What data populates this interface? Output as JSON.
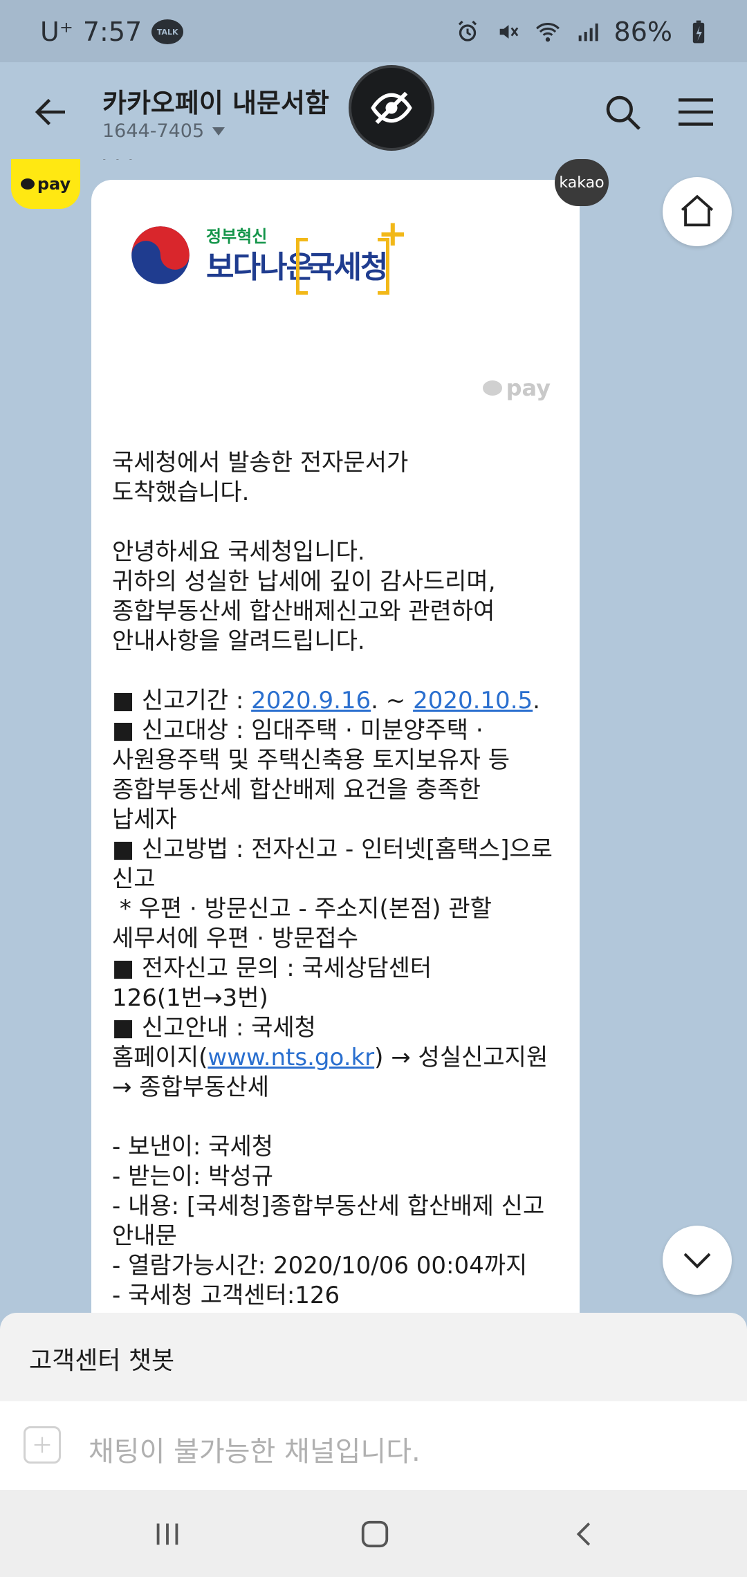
{
  "status_bar": {
    "carrier": "U⁺",
    "time": "7:57",
    "talk_label": "TALK",
    "battery": "86%"
  },
  "header": {
    "title": "카카오페이 내문서함",
    "phone": "1644-7405"
  },
  "message": {
    "sender_cut": "· · ·",
    "kakao_badge": "kakao",
    "logo_small": "정부혁신",
    "logo_big": "보다나은",
    "logo_org": "국세청",
    "pay_label": "pay",
    "intro": "국세청에서 발송한 전자문서가\n도착했습니다.",
    "greeting": "안녕하세요 국세청입니다.\n귀하의 성실한 납세에 깊이 감사드리며,\n종합부동산세 합산배제신고와 관련하여\n안내사항을 알려드립니다.",
    "period_label": "■ 신고기간 : ",
    "period_start": "2020.9.16",
    "period_sep": ". ~ ",
    "period_end": "2020.10.5",
    "period_end_dot": ".",
    "target": "■ 신고대상 : 임대주택 · 미분양주택 ·\n사원용주택 및 주택신축용 토지보유자 등\n종합부동산세 합산배제 요건을 충족한\n납세자",
    "method": "■ 신고방법 : 전자신고 - 인터넷[홈택스]으로\n신고\n * 우편 · 방문신고 - 주소지(본점) 관할\n세무서에 우편 · 방문접수",
    "inquiry": "■ 전자신고 문의 : 국세상담센터\n126(1번→3번)",
    "guide_prefix": "■ 신고안내 : 국세청\n홈페이지(",
    "guide_link": "www.nts.go.kr",
    "guide_suffix": ") → 성실신고지원\n→ 종합부동산세",
    "details": "- 보낸이: 국세청\n- 받는이: 박성규\n- 내용: [국세청]종합부동산세 합산배제 신고\n안내문\n- 열람가능시간: 2020/10/06 00:04까지\n- 국세청 고객센터:126"
  },
  "chatbot": {
    "label": "고객센터 챗봇"
  },
  "input": {
    "placeholder": "채팅이 불가능한 채널입니다."
  },
  "icons": {
    "back": "arrow-left-icon",
    "eye": "eye-off-icon",
    "search": "search-icon",
    "menu": "hamburger-icon",
    "home": "home-icon",
    "down": "chevron-down-icon"
  },
  "colors": {
    "background": "#b2c7da",
    "status_bar": "#a5b9cc",
    "kakao_yellow": "#ffe812",
    "link": "#2a6fcf",
    "logo_blue": "#1f3c8f",
    "logo_yellow": "#f2b818",
    "logo_green": "#14954a"
  }
}
